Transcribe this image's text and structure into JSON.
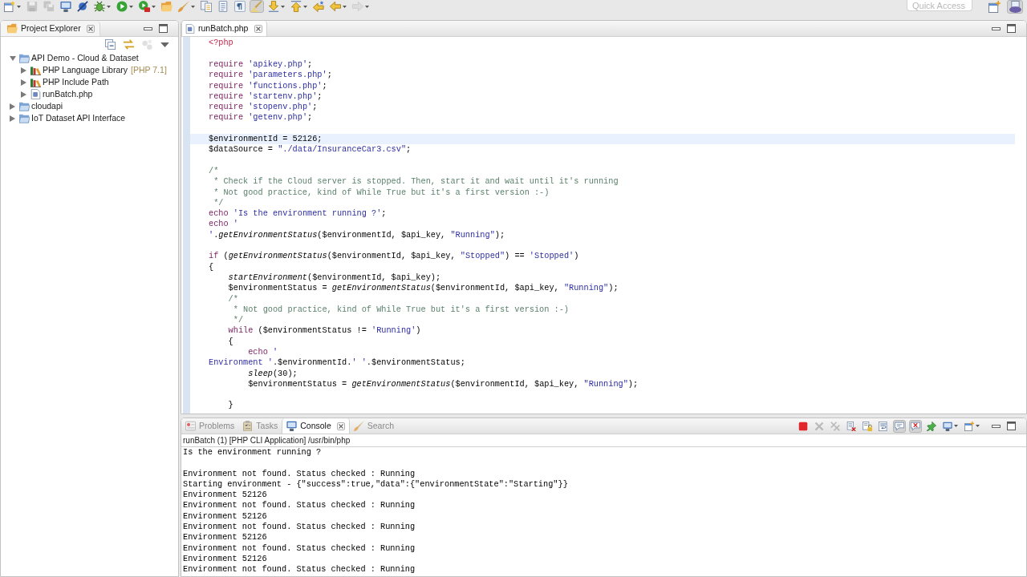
{
  "toolbar": {
    "items": [
      {
        "kind": "new_wizard",
        "dropdown": true,
        "disabled": false,
        "pressed": false
      },
      {
        "kind": "save",
        "dropdown": false,
        "disabled": true,
        "pressed": false
      },
      {
        "kind": "save_all",
        "dropdown": false,
        "disabled": true,
        "pressed": false
      },
      {
        "kind": "terminal",
        "dropdown": false,
        "disabled": false,
        "pressed": false
      },
      {
        "kind": "skip_breakpoints",
        "dropdown": false,
        "disabled": false,
        "pressed": false
      },
      {
        "kind": "debug",
        "dropdown": true,
        "disabled": false,
        "pressed": false
      },
      {
        "kind": "run",
        "dropdown": true,
        "disabled": false,
        "pressed": false
      },
      {
        "kind": "run_external",
        "dropdown": true,
        "disabled": false,
        "pressed": false
      },
      {
        "kind": "open_type",
        "dropdown": false,
        "disabled": false,
        "pressed": false
      },
      {
        "kind": "search",
        "dropdown": true,
        "disabled": false,
        "pressed": false
      },
      {
        "kind": "breadcrumb",
        "dropdown": false,
        "disabled": false,
        "pressed": false
      },
      {
        "kind": "outline",
        "dropdown": false,
        "disabled": false,
        "pressed": false
      },
      {
        "kind": "show_whitespace",
        "dropdown": false,
        "disabled": false,
        "pressed": false
      },
      {
        "kind": "mark_occurrences",
        "dropdown": false,
        "disabled": false,
        "pressed": true
      },
      {
        "kind": "next_annotation",
        "dropdown": true,
        "disabled": false,
        "pressed": false
      },
      {
        "kind": "previous_annotation",
        "dropdown": true,
        "disabled": false,
        "pressed": false
      },
      {
        "kind": "last_edit",
        "dropdown": false,
        "disabled": false,
        "pressed": false
      },
      {
        "kind": "back",
        "dropdown": true,
        "disabled": false,
        "pressed": false
      },
      {
        "kind": "forward",
        "dropdown": true,
        "disabled": true,
        "pressed": false
      }
    ],
    "quick_access": {
      "placeholder": "Quick Access"
    },
    "perspectives": [
      {
        "kind": "open_perspective",
        "selected": false
      },
      {
        "kind": "php",
        "selected": true
      }
    ]
  },
  "project_explorer": {
    "title": "Project Explorer",
    "toolbar": [
      {
        "kind": "collapse_all",
        "disabled": false
      },
      {
        "kind": "link_with_editor",
        "disabled": false
      },
      {
        "kind": "focus",
        "disabled": true
      },
      {
        "kind": "view_menu",
        "disabled": false
      }
    ],
    "tree": [
      {
        "label": "API Demo - Cloud & Dataset",
        "kind": "project",
        "expanded": true,
        "selected": false,
        "children": [
          {
            "label": "PHP Language Library",
            "decoration": "[PHP 7.1]",
            "kind": "library",
            "expanded": false,
            "selected": false
          },
          {
            "label": "PHP Include Path",
            "kind": "library",
            "expanded": false,
            "selected": false
          },
          {
            "label": "runBatch.php",
            "kind": "file",
            "expanded": false,
            "selected": false
          }
        ]
      },
      {
        "label": "cloudapi",
        "kind": "project",
        "expanded": false,
        "selected": false
      },
      {
        "label": "IoT Dataset API Interface",
        "kind": "project",
        "expanded": false,
        "selected": false
      }
    ]
  },
  "editor": {
    "tabs": [
      {
        "label": "runBatch.php",
        "selected": true
      }
    ],
    "lines": [
      {
        "kind": "code",
        "current": false,
        "tokens": [
          {
            "kind": "php_tag",
            "text": "<?php"
          }
        ]
      },
      {
        "kind": "blank",
        "current": false
      },
      {
        "kind": "code",
        "current": false,
        "tokens": [
          {
            "kind": "keyword",
            "text": "require "
          },
          {
            "kind": "string",
            "text": "'apikey.php'"
          },
          {
            "kind": "plain",
            "text": ";"
          }
        ]
      },
      {
        "kind": "code",
        "current": false,
        "tokens": [
          {
            "kind": "keyword",
            "text": "require "
          },
          {
            "kind": "string",
            "text": "'parameters.php'"
          },
          {
            "kind": "plain",
            "text": ";"
          }
        ]
      },
      {
        "kind": "code",
        "current": false,
        "tokens": [
          {
            "kind": "keyword",
            "text": "require "
          },
          {
            "kind": "string",
            "text": "'functions.php'"
          },
          {
            "kind": "plain",
            "text": ";"
          }
        ]
      },
      {
        "kind": "code",
        "current": false,
        "tokens": [
          {
            "kind": "keyword",
            "text": "require "
          },
          {
            "kind": "string",
            "text": "'startenv.php'"
          },
          {
            "kind": "plain",
            "text": ";"
          }
        ]
      },
      {
        "kind": "code",
        "current": false,
        "tokens": [
          {
            "kind": "keyword",
            "text": "require "
          },
          {
            "kind": "string",
            "text": "'stopenv.php'"
          },
          {
            "kind": "plain",
            "text": ";"
          }
        ]
      },
      {
        "kind": "code",
        "current": false,
        "tokens": [
          {
            "kind": "keyword",
            "text": "require "
          },
          {
            "kind": "string",
            "text": "'getenv.php'"
          },
          {
            "kind": "plain",
            "text": ";"
          }
        ]
      },
      {
        "kind": "blank",
        "current": false
      },
      {
        "kind": "code",
        "current": true,
        "tokens": [
          {
            "kind": "plain",
            "text": "$environmentId = 52126;"
          }
        ]
      },
      {
        "kind": "code",
        "current": false,
        "tokens": [
          {
            "kind": "plain",
            "text": "$dataSource = "
          },
          {
            "kind": "string",
            "text": "\"./data/InsuranceCar3.csv\""
          },
          {
            "kind": "plain",
            "text": ";"
          }
        ]
      },
      {
        "kind": "blank",
        "current": false
      },
      {
        "kind": "code",
        "current": false,
        "tokens": [
          {
            "kind": "comment",
            "text": "/*"
          }
        ]
      },
      {
        "kind": "code",
        "current": false,
        "tokens": [
          {
            "kind": "comment",
            "text": " * Check if the Cloud server is stopped. Then, start it and wait until it's running"
          }
        ]
      },
      {
        "kind": "code",
        "current": false,
        "tokens": [
          {
            "kind": "comment",
            "text": " * Not good practice, kind of While True but it's a first version :-)"
          }
        ]
      },
      {
        "kind": "code",
        "current": false,
        "tokens": [
          {
            "kind": "comment",
            "text": " */"
          }
        ]
      },
      {
        "kind": "code",
        "current": false,
        "tokens": [
          {
            "kind": "keyword",
            "text": "echo "
          },
          {
            "kind": "string",
            "text": "'Is the environment running ?'"
          },
          {
            "kind": "plain",
            "text": ";"
          }
        ]
      },
      {
        "kind": "code",
        "current": false,
        "tokens": [
          {
            "kind": "keyword",
            "text": "echo "
          },
          {
            "kind": "string",
            "text": "'"
          }
        ]
      },
      {
        "kind": "code",
        "current": false,
        "tokens": [
          {
            "kind": "string",
            "text": "'"
          },
          {
            "kind": "plain",
            "text": "."
          },
          {
            "kind": "function",
            "text": "getEnvironmentStatus"
          },
          {
            "kind": "plain",
            "text": "($environmentId, $api_key, "
          },
          {
            "kind": "string",
            "text": "\"Running\""
          },
          {
            "kind": "plain",
            "text": ");"
          }
        ]
      },
      {
        "kind": "blank",
        "current": false
      },
      {
        "kind": "code",
        "current": false,
        "tokens": [
          {
            "kind": "keyword",
            "text": "if"
          },
          {
            "kind": "plain",
            "text": " ("
          },
          {
            "kind": "function",
            "text": "getEnvironmentStatus"
          },
          {
            "kind": "plain",
            "text": "($environmentId, $api_key, "
          },
          {
            "kind": "string",
            "text": "\"Stopped\""
          },
          {
            "kind": "plain",
            "text": ") == "
          },
          {
            "kind": "string",
            "text": "'Stopped'"
          },
          {
            "kind": "plain",
            "text": ")"
          }
        ]
      },
      {
        "kind": "code",
        "current": false,
        "tokens": [
          {
            "kind": "plain",
            "text": "{"
          }
        ]
      },
      {
        "kind": "code",
        "current": false,
        "tokens": [
          {
            "kind": "function",
            "text": "    startEnvironment"
          },
          {
            "kind": "plain",
            "text": "($environmentId, $api_key);"
          }
        ]
      },
      {
        "kind": "code",
        "current": false,
        "tokens": [
          {
            "kind": "plain",
            "text": "    $environmentStatus = "
          },
          {
            "kind": "function",
            "text": "getEnvironmentStatus"
          },
          {
            "kind": "plain",
            "text": "($environmentId, $api_key, "
          },
          {
            "kind": "string",
            "text": "\"Running\""
          },
          {
            "kind": "plain",
            "text": ");"
          }
        ]
      },
      {
        "kind": "code",
        "current": false,
        "tokens": [
          {
            "kind": "comment",
            "text": "    /*"
          }
        ]
      },
      {
        "kind": "code",
        "current": false,
        "tokens": [
          {
            "kind": "comment",
            "text": "     * Not good practice, kind of While True but it's a first version :-)"
          }
        ]
      },
      {
        "kind": "code",
        "current": false,
        "tokens": [
          {
            "kind": "comment",
            "text": "     */"
          }
        ]
      },
      {
        "kind": "code",
        "current": false,
        "tokens": [
          {
            "kind": "keyword",
            "text": "    while"
          },
          {
            "kind": "plain",
            "text": " ($environmentStatus != "
          },
          {
            "kind": "string",
            "text": "'Running'"
          },
          {
            "kind": "plain",
            "text": ")"
          }
        ]
      },
      {
        "kind": "code",
        "current": false,
        "tokens": [
          {
            "kind": "plain",
            "text": "    {"
          }
        ]
      },
      {
        "kind": "code",
        "current": false,
        "tokens": [
          {
            "kind": "keyword",
            "text": "        echo "
          },
          {
            "kind": "string",
            "text": "'"
          }
        ]
      },
      {
        "kind": "code",
        "current": false,
        "tokens": [
          {
            "kind": "string",
            "text": "Environment '"
          },
          {
            "kind": "plain",
            "text": ".$environmentId."
          },
          {
            "kind": "string",
            "text": "' '"
          },
          {
            "kind": "plain",
            "text": ".$environmentStatus;"
          }
        ]
      },
      {
        "kind": "code",
        "current": false,
        "tokens": [
          {
            "kind": "function",
            "text": "        sleep"
          },
          {
            "kind": "plain",
            "text": "(30);"
          }
        ]
      },
      {
        "kind": "code",
        "current": false,
        "tokens": [
          {
            "kind": "plain",
            "text": "        $environmentStatus = "
          },
          {
            "kind": "function",
            "text": "getEnvironmentStatus"
          },
          {
            "kind": "plain",
            "text": "($environmentId, $api_key, "
          },
          {
            "kind": "string",
            "text": "\"Running\""
          },
          {
            "kind": "plain",
            "text": ");"
          }
        ]
      },
      {
        "kind": "blank",
        "current": false
      },
      {
        "kind": "code",
        "current": false,
        "tokens": [
          {
            "kind": "plain",
            "text": "    }"
          }
        ]
      }
    ]
  },
  "console": {
    "tabs": [
      {
        "label": "Problems",
        "kind": "problems",
        "selected": false
      },
      {
        "label": "Tasks",
        "kind": "tasks",
        "selected": false
      },
      {
        "label": "Console",
        "kind": "console",
        "selected": true
      },
      {
        "label": "Search",
        "kind": "search",
        "selected": false
      }
    ],
    "toolbar": [
      {
        "kind": "terminate",
        "dropdown": false,
        "disabled": false,
        "pressed": false
      },
      {
        "kind": "remove_launch",
        "dropdown": false,
        "disabled": true,
        "pressed": false
      },
      {
        "kind": "remove_all",
        "dropdown": false,
        "disabled": true,
        "pressed": false
      },
      {
        "kind": "clear",
        "dropdown": false,
        "disabled": false,
        "pressed": false
      },
      {
        "kind": "scroll_lock",
        "dropdown": false,
        "disabled": false,
        "pressed": false
      },
      {
        "kind": "word_wrap",
        "dropdown": false,
        "disabled": false,
        "pressed": false
      },
      {
        "kind": "show_stdout",
        "dropdown": false,
        "disabled": false,
        "pressed": true
      },
      {
        "kind": "show_stderr",
        "dropdown": false,
        "disabled": false,
        "pressed": true
      },
      {
        "kind": "pin",
        "dropdown": false,
        "disabled": false,
        "pressed": false
      },
      {
        "kind": "display_console",
        "dropdown": true,
        "disabled": false,
        "pressed": false
      },
      {
        "kind": "open_console",
        "dropdown": true,
        "disabled": false,
        "pressed": false
      }
    ],
    "process": "runBatch (1) [PHP CLI Application] /usr/bin/php",
    "lines": [
      {
        "kind": "output",
        "text": "Is the environment running ?"
      },
      {
        "kind": "blank"
      },
      {
        "kind": "output",
        "text": "Environment not found. Status checked : Running"
      },
      {
        "kind": "output",
        "text": "Starting environment - {\"success\":true,\"data\":{\"environmentState\":\"Starting\"}}"
      },
      {
        "kind": "output",
        "text": "Environment 52126"
      },
      {
        "kind": "output",
        "text": "Environment not found. Status checked : Running"
      },
      {
        "kind": "output",
        "text": "Environment 52126"
      },
      {
        "kind": "output",
        "text": "Environment not found. Status checked : Running"
      },
      {
        "kind": "output",
        "text": "Environment 52126"
      },
      {
        "kind": "output",
        "text": "Environment not found. Status checked : Running"
      },
      {
        "kind": "output",
        "text": "Environment 52126"
      },
      {
        "kind": "output",
        "text": "Environment not found. Status checked : Running"
      }
    ]
  }
}
